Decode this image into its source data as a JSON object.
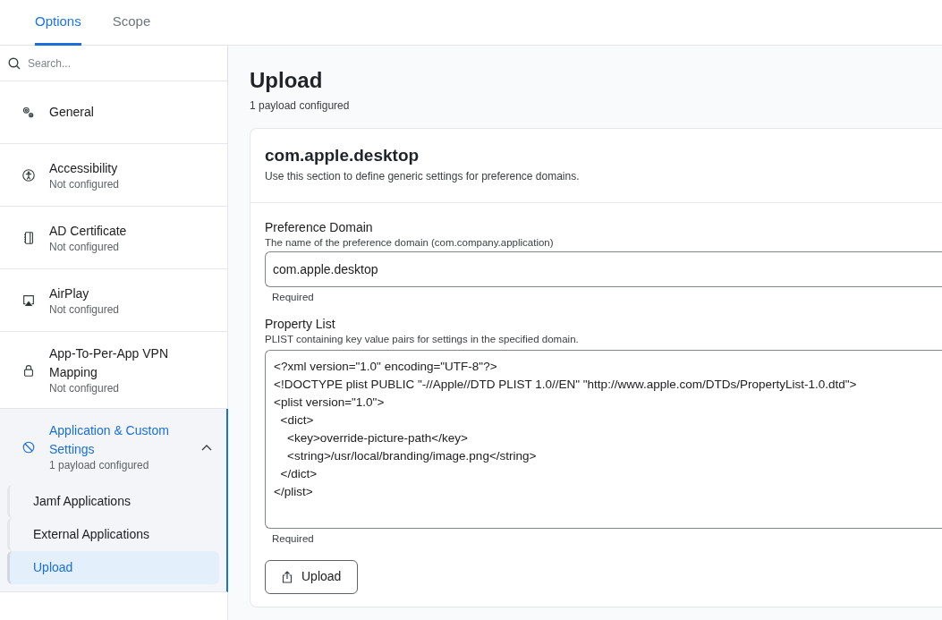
{
  "tabs": [
    {
      "label": "Options",
      "selected": true
    },
    {
      "label": "Scope",
      "selected": false
    }
  ],
  "sidebar": {
    "search": {
      "placeholder": "Search..."
    },
    "items": [
      {
        "kind": "gears",
        "label": "General",
        "selected": false
      },
      {
        "kind": "accessibility",
        "label": "Accessibility",
        "status": "Not configured",
        "selected": false
      },
      {
        "kind": "certificate",
        "label": "AD Certificate",
        "status": "Not configured",
        "selected": false
      },
      {
        "kind": "airplay",
        "label": "AirPlay",
        "status": "Not configured",
        "selected": false
      },
      {
        "kind": "lock",
        "label": "App-To-Per-App VPN Mapping",
        "status": "Not configured",
        "selected": false
      },
      {
        "kind": "blocked",
        "label": "Application & Custom Settings",
        "status": "1 payload configured",
        "selected": true,
        "expanded": true,
        "children": [
          {
            "label": "Jamf Applications",
            "selected": false
          },
          {
            "label": "External Applications",
            "selected": false
          },
          {
            "label": "Upload",
            "selected": true
          }
        ]
      }
    ]
  },
  "main": {
    "title": "Upload",
    "subtitle": "1 payload configured",
    "card": {
      "title": "com.apple.desktop",
      "description": "Use this section to define generic settings for preference domains.",
      "fields": [
        {
          "kind": "input",
          "label": "Preference Domain",
          "help": "The name of the preference domain (com.company.application)",
          "value": "com.apple.desktop",
          "note": "Required"
        },
        {
          "kind": "textarea",
          "label": "Property List",
          "help": "PLIST containing key value pairs for settings in the specified domain.",
          "value": "<?xml version=\"1.0\" encoding=\"UTF-8\"?>\n<!DOCTYPE plist PUBLIC \"-//Apple//DTD PLIST 1.0//EN\" \"http://www.apple.com/DTDs/PropertyList-1.0.dtd\">\n<plist version=\"1.0\">\n  <dict>\n    <key>override-picture-path</key>\n    <string>/usr/local/branding/image.png</string>\n  </dict>\n</plist>",
          "note": "Required"
        }
      ],
      "button": "Upload"
    }
  }
}
